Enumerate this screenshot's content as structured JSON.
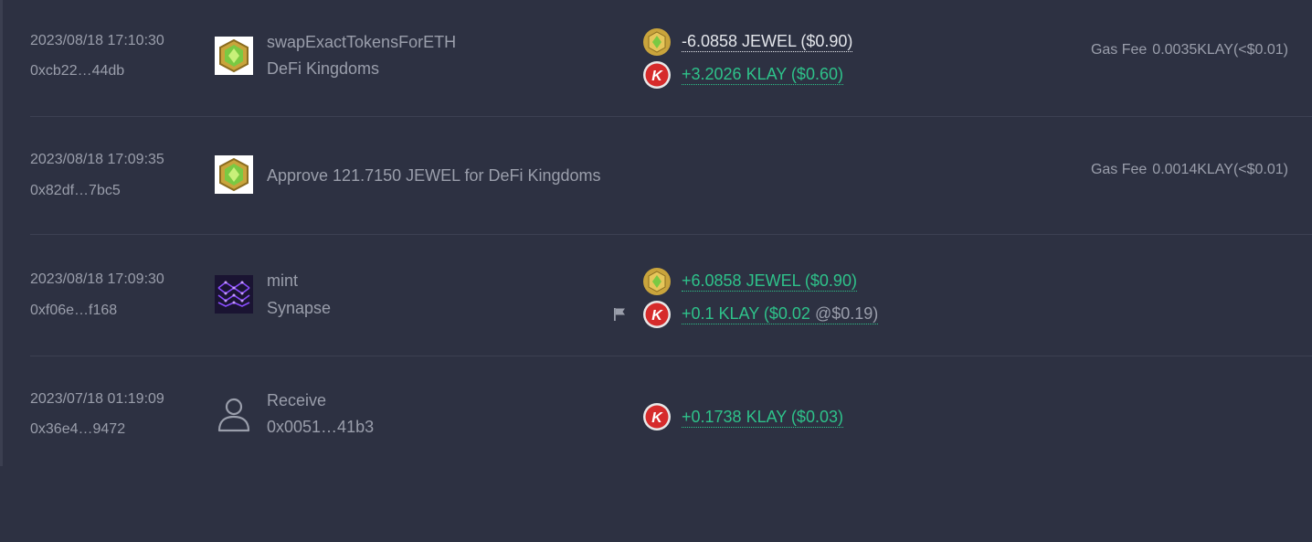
{
  "transactions": [
    {
      "time": "2023/08/18 17:10:30",
      "hash": "0xcb22…44db",
      "action": "swapExactTokensForETH",
      "app": "DeFi Kingdoms",
      "app_icon": "defi-kingdoms-icon",
      "amounts": [
        {
          "text": "-6.0858 JEWEL ($0.90)",
          "token_icon": "jewel-icon",
          "color": "#e3e5ea"
        },
        {
          "text": "+3.2026 KLAY ($0.60)",
          "token_icon": "klay-icon",
          "color": "#2ec28a"
        }
      ],
      "gas_label": "Gas Fee",
      "gas_value": "0.0035KLAY(<$0.01)"
    },
    {
      "time": "2023/08/18 17:09:35",
      "hash": "0x82df…7bc5",
      "action": "Approve 121.7150 JEWEL for DeFi Kingdoms",
      "app_icon": "defi-kingdoms-icon",
      "gas_label": "Gas Fee",
      "gas_value": "0.0014KLAY(<$0.01)"
    },
    {
      "time": "2023/08/18 17:09:30",
      "hash": "0xf06e…f168",
      "action": "mint",
      "app": "Synapse",
      "app_icon": "synapse-icon",
      "amounts": [
        {
          "text": "+6.0858 JEWEL ($0.90)",
          "token_icon": "jewel-icon",
          "color": "#2ec28a"
        },
        {
          "text": "+0.1 KLAY ($0.02",
          "price": "@$0.19)",
          "token_icon": "klay-icon",
          "color": "#2ec28a",
          "flag_icon": "flag-icon"
        }
      ]
    },
    {
      "time": "2023/07/18 01:19:09",
      "hash": "0x36e4…9472",
      "action": "Receive",
      "app": "0x0051…41b3",
      "app_icon": "user-icon",
      "amounts": [
        {
          "text": "+0.1738 KLAY ($0.03)",
          "token_icon": "klay-icon",
          "color": "#2ec28a"
        }
      ]
    }
  ],
  "colors": {
    "background": "#2d3142",
    "positive": "#2ec28a",
    "negative": "#e3e5ea",
    "muted": "#9a9eab"
  }
}
